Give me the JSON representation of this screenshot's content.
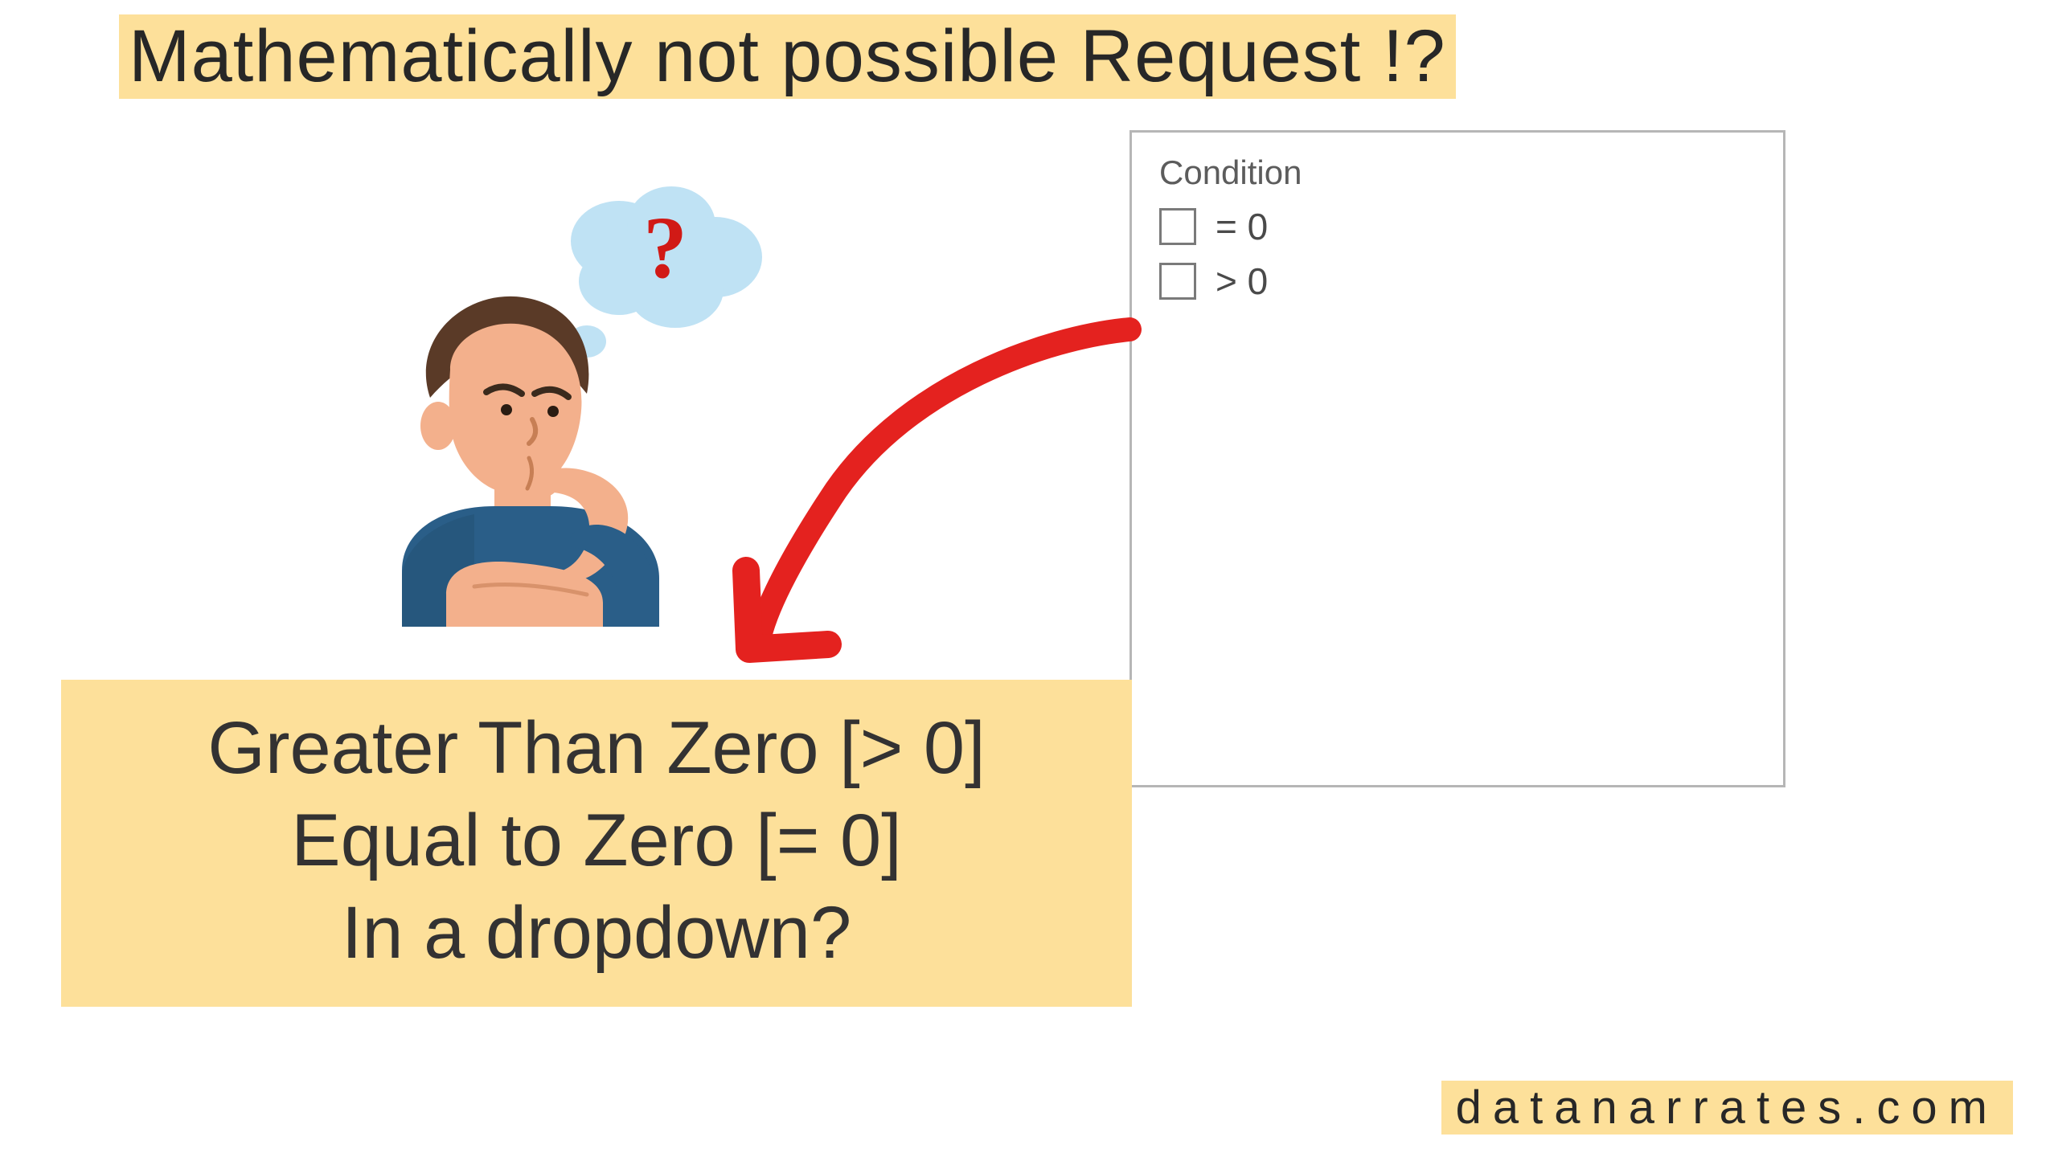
{
  "title": "Mathematically not possible Request !?",
  "condition": {
    "heading": "Condition",
    "options": [
      {
        "label": "= 0"
      },
      {
        "label": "> 0"
      }
    ]
  },
  "bottom": {
    "line1": "Greater Than Zero [> 0]",
    "line2": "Equal to Zero [= 0]",
    "line3": "In a dropdown?"
  },
  "brand": "datanarrates.com",
  "icons": {
    "thinker": "thinking-person-icon",
    "arrow": "curved-arrow-icon"
  },
  "colors": {
    "highlight": "#fde09a",
    "arrow": "#e4221f",
    "panel_border": "#b6b6b6"
  }
}
